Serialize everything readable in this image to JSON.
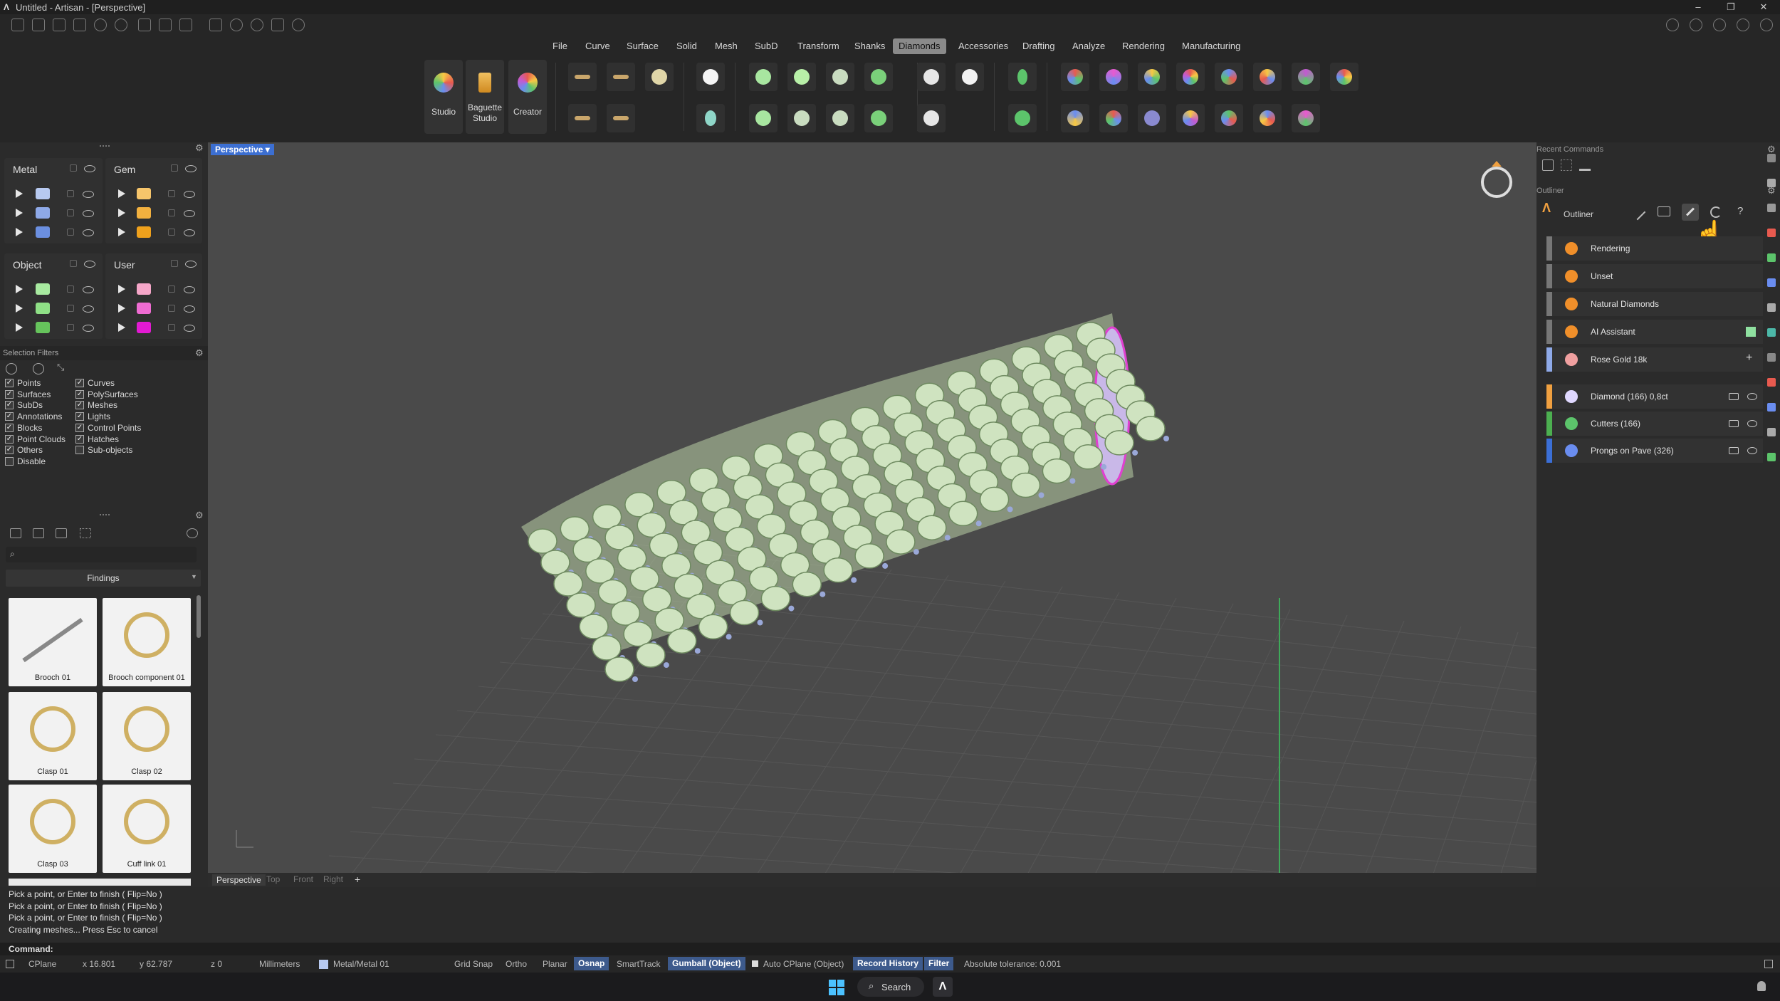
{
  "window": {
    "title": "Untitled - Artisan - [Perspective]"
  },
  "menus": [
    "File",
    "Curve",
    "Surface",
    "Solid",
    "Mesh",
    "SubD",
    "Transform",
    "Shanks",
    "Diamonds",
    "Accessories",
    "Drafting",
    "Analyze",
    "Rendering",
    "Manufacturing"
  ],
  "active_menu": "Diamonds",
  "ribbon": {
    "big_buttons": [
      {
        "label": "Studio",
        "icon": "gem-color-icon"
      },
      {
        "label": "Baguette\nStudio",
        "icon": "baguette-icon"
      },
      {
        "label": "Creator",
        "icon": "creator-icon"
      }
    ]
  },
  "layers": {
    "metal": {
      "title": "Metal",
      "colors": [
        "#b7c9f0",
        "#8ea9e8",
        "#6b8fe0"
      ]
    },
    "gem": {
      "title": "Gem",
      "colors": [
        "#f6c56b",
        "#f3b13f",
        "#efa11c"
      ]
    },
    "object": {
      "title": "Object",
      "colors": [
        "#a8eaa0",
        "#8fe086",
        "#66c45c"
      ]
    },
    "user": {
      "title": "User",
      "colors": [
        "#f5a6c8",
        "#ef6cd2",
        "#e21ad2"
      ]
    }
  },
  "selection_filters": {
    "title": "Selection Filters",
    "col1": [
      "Points",
      "Surfaces",
      "SubDs",
      "Annotations",
      "Blocks",
      "Point Clouds",
      "Others",
      "Disable"
    ],
    "col1_checked": [
      true,
      true,
      true,
      true,
      true,
      true,
      true,
      false
    ],
    "col2": [
      "Curves",
      "PolySurfaces",
      "Meshes",
      "Lights",
      "Control Points",
      "Hatches",
      "Sub-objects"
    ],
    "col2_checked": [
      true,
      true,
      true,
      true,
      true,
      true,
      false
    ]
  },
  "library": {
    "category": "Findings",
    "items": [
      "Brooch 01",
      "Brooch component 01",
      "Clasp 01",
      "Clasp 02",
      "Clasp 03",
      "Cuff link 01"
    ]
  },
  "viewport": {
    "active_tab": "Perspective",
    "tabs": [
      "Perspective",
      "Top",
      "Front",
      "Right"
    ],
    "add_tab": "+"
  },
  "right_panel": {
    "recent_commands_title": "Recent Commands",
    "outliner_title": "Outliner",
    "outliner_tab": "Outliner",
    "materials": [
      {
        "label": "Rendering",
        "color": "#f08f2a"
      },
      {
        "label": "Unset",
        "color": "#f08f2a"
      },
      {
        "label": "Natural Diamonds",
        "color": "#f08f2a"
      },
      {
        "label": "AI Assistant",
        "color": "#f08f2a"
      },
      {
        "label": "Rose Gold 18k",
        "color": "#f0a0a0"
      }
    ],
    "objects": [
      {
        "label": "Diamond (166) 0,8ct",
        "bar": "#f0a040"
      },
      {
        "label": "Cutters (166)",
        "bar": "#4caf50"
      },
      {
        "label": "Prongs on Pave (326)",
        "bar": "#3b6fd6"
      }
    ]
  },
  "command_history": [
    "Pick a point, or Enter to finish ( Flip=No )",
    "Pick a point, or Enter to finish ( Flip=No )",
    "Pick a point, or Enter to finish ( Flip=No )",
    "Creating meshes... Press Esc to cancel"
  ],
  "command_prompt": "Command:",
  "status": {
    "cplane": "CPlane",
    "x": "x 16.801",
    "y": "y 62.787",
    "z": "z 0",
    "units": "Millimeters",
    "layer": "Metal/Metal 01",
    "grid_snap": "Grid Snap",
    "ortho": "Ortho",
    "planar": "Planar",
    "osnap": "Osnap",
    "smarttrack": "SmartTrack",
    "gumball": "Gumball (Object)",
    "auto_cplane": "Auto CPlane (Object)",
    "record_history": "Record History",
    "filter": "Filter",
    "tolerance": "Absolute tolerance: 0.001"
  },
  "taskbar": {
    "search": "Search"
  }
}
